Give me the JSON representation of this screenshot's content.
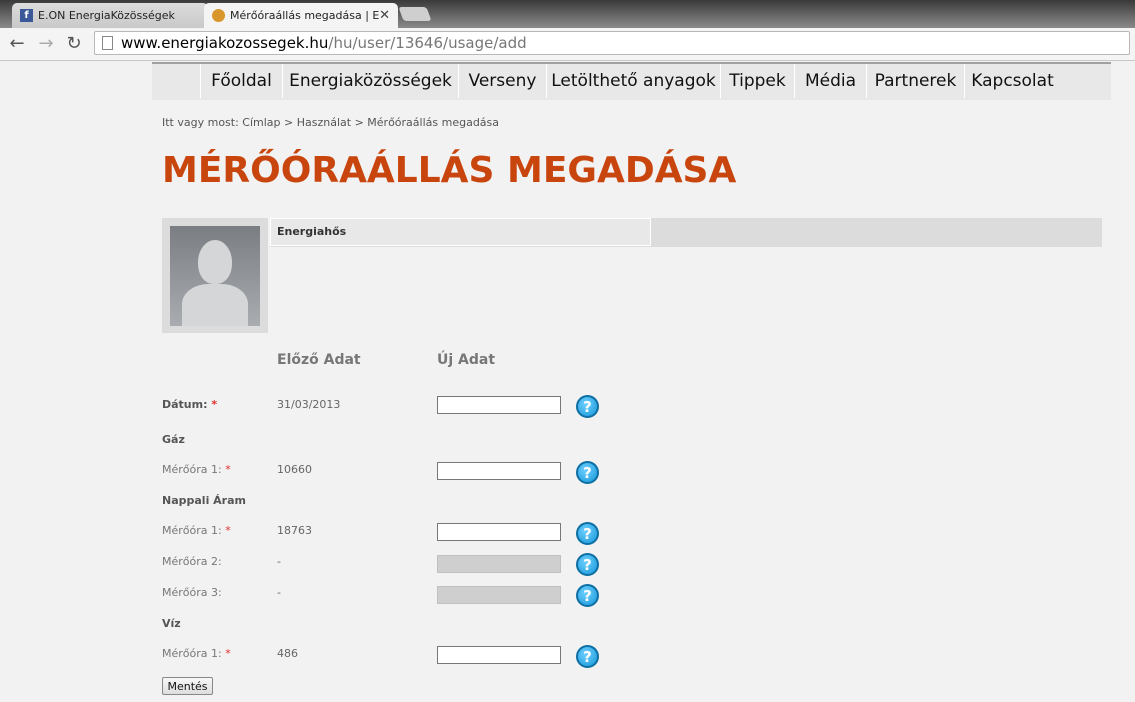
{
  "browser": {
    "tabs": [
      {
        "title": "E.ON EnergiaKözösségek",
        "favicon": "facebook-icon",
        "active": false
      },
      {
        "title": "Mérőóraállás megadása | E",
        "favicon": "energy-community-icon",
        "active": true,
        "close": "✕"
      }
    ],
    "nav": {
      "back": "←",
      "forward": "→",
      "reload": "↻"
    },
    "url": {
      "host": "www.energiakozossegek.hu",
      "path": "/hu/user/13646/usage/add"
    }
  },
  "sitenav": {
    "items": [
      "Főoldal",
      "Energiaközösségek",
      "Verseny",
      "Letölthető anyagok",
      "Tippek",
      "Média",
      "Partnerek",
      "Kapcsolat"
    ]
  },
  "breadcrumb": "Itt vagy most: Címlap > Használat > Mérőóraállás megadása",
  "page_title": "MÉRŐÓRAÁLLÁS MEGADÁSA",
  "profile": {
    "name": "Energiahős",
    "avatar": "default-avatar-icon"
  },
  "form": {
    "col_prev": "Előző Adat",
    "col_new": "Új Adat",
    "req_mark": "*",
    "help_glyph": "?",
    "date": {
      "label": "Dátum:",
      "prev": "31/03/2013",
      "value": ""
    },
    "gas": {
      "title": "Gáz",
      "meter1": {
        "label": "Mérőóra 1:",
        "prev": "10660",
        "value": ""
      }
    },
    "day_power": {
      "title": "Nappali Áram",
      "meter1": {
        "label": "Mérőóra 1:",
        "prev": "18763",
        "value": ""
      },
      "meter2": {
        "label": "Mérőóra 2:",
        "prev": "-",
        "value": ""
      },
      "meter3": {
        "label": "Mérőóra 3:",
        "prev": "-",
        "value": ""
      }
    },
    "water": {
      "title": "Víz",
      "meter1": {
        "label": "Mérőóra 1:",
        "prev": "486",
        "value": ""
      }
    },
    "save_label": "Mentés"
  }
}
